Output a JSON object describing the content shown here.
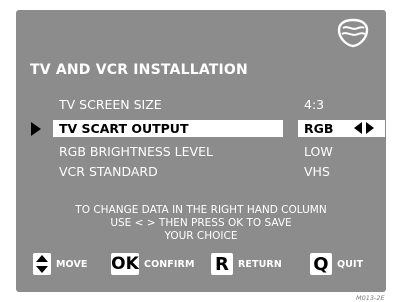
{
  "screen": {
    "title": "TV AND VCR INSTALLATION",
    "logo_icon": "philips-shield-logo-icon"
  },
  "menu": {
    "rows": [
      {
        "label": "TV SCREEN SIZE",
        "value": "4:3",
        "selected": false
      },
      {
        "label": "TV SCART OUTPUT",
        "value": "RGB",
        "selected": true
      },
      {
        "label": "RGB BRIGHTNESS LEVEL",
        "value": "LOW",
        "selected": false
      },
      {
        "label": "VCR STANDARD",
        "value": "VHS",
        "selected": false
      }
    ]
  },
  "help": {
    "lines": [
      "TO CHANGE DATA IN THE RIGHT HAND COLUMN",
      "USE < > THEN PRESS OK TO SAVE",
      "YOUR CHOICE"
    ]
  },
  "nav": {
    "move": {
      "key": "",
      "label": "MOVE",
      "icon": "up-down-arrows-icon"
    },
    "confirm": {
      "key": "OK",
      "label": "CONFIRM"
    },
    "return": {
      "key": "R",
      "label": "RETURN"
    },
    "quit": {
      "key": "Q",
      "label": "QUIT"
    }
  },
  "figure_code": "M013-2E",
  "colors": {
    "screen_background": "#8c8c8c",
    "text": "#ffffff",
    "highlight": "#ffffff",
    "highlight_text": "#000000"
  }
}
